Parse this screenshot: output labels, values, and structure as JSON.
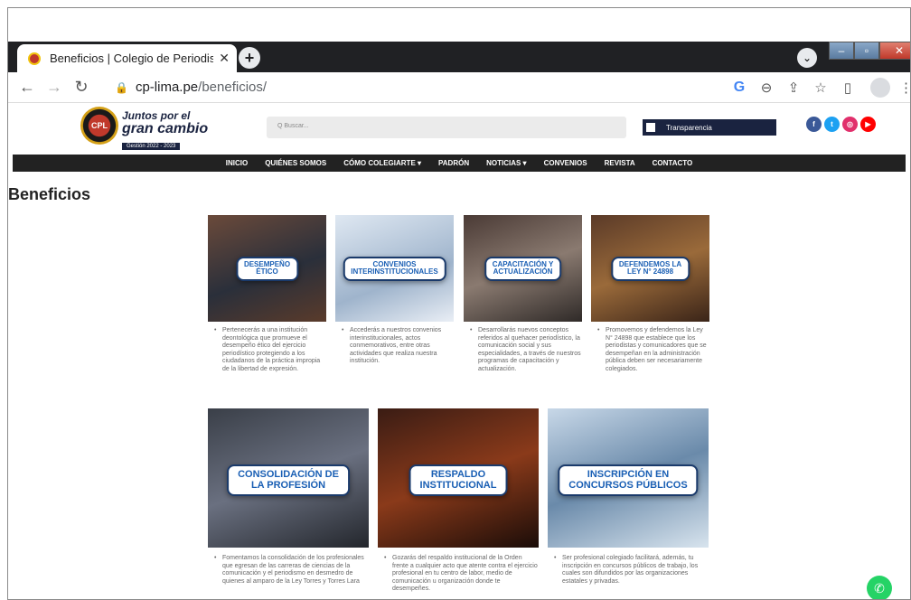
{
  "browser": {
    "tab_title": "Beneficios | Colegio de Periodista",
    "tab_close": "✕",
    "new_tab": "+",
    "tab_dropdown": "⌄",
    "url_domain": "cp-lima.pe",
    "url_path": "/beneficios/",
    "back": "←",
    "forward": "→",
    "reload": "↻",
    "lock": "🔒",
    "tb_icons": [
      "G",
      "⊖",
      "⇪",
      "☆",
      "▯",
      "⋮"
    ],
    "win": [
      "–",
      "▫",
      "✕"
    ]
  },
  "header": {
    "logo_text": "CPL",
    "slogan_1": "Juntos por el",
    "slogan_2": "gran cambio",
    "slogan_3": "Gestión 2022 - 2023",
    "search_placeholder": "Q  Buscar...",
    "transparencia": "Transparencia",
    "social": [
      {
        "icon": "f",
        "color": "#3b5998"
      },
      {
        "icon": "t",
        "color": "#1da1f2"
      },
      {
        "icon": "◎",
        "color": "#e1306c"
      },
      {
        "icon": "▶",
        "color": "#ff0000"
      }
    ]
  },
  "menu": [
    "INICIO",
    "QUIÉNES SOMOS",
    "CÓMO COLEGIARTE ▾",
    "PADRÓN",
    "NOTICIAS ▾",
    "CONVENIOS",
    "REVISTA",
    "CONTACTO"
  ],
  "page_title": "Beneficios",
  "cards": [
    {
      "banner": "DESEMPEÑO\nÉTICO",
      "desc": "Pertenecerás a una institución deontológica que promueve el desempeño ético del ejercicio periodístico protegiendo a los ciudadanos de la práctica impropia de la libertad de expresión."
    },
    {
      "banner": "CONVENIOS\nINTERINSTITUCIONALES",
      "desc": "Accederás a nuestros convenios interinstitucionales, actos conmemorativos, entre otras actividades que realiza nuestra institución."
    },
    {
      "banner": "CAPACITACIÓN Y\nACTUALIZACIÓN",
      "desc": "Desarrollarás nuevos conceptos referidos al quehacer periodístico, la comunicación social y sus especialidades, a través de nuestros programas de capacitación y actualización."
    },
    {
      "banner": "DEFENDEMOS LA\nLEY N° 24898",
      "desc": "Promovemos y defendemos la Ley N° 24898 que establece que los periodistas y comunicadores que se desempeñan en la administración pública deben ser necesariamente colegiados."
    },
    {
      "banner": "CONSOLIDACIÓN DE\nLA PROFESIÓN",
      "desc": "Fomentamos la consolidación de los profesionales que egresan de las carreras de ciencias de la comunicación y el periodismo en desmedro de quienes al amparo de la Ley Torres y Torres Lara"
    },
    {
      "banner": "RESPALDO\nINSTITUCIONAL",
      "desc": "Gozarás del respaldo institucional de la Orden frente a cualquier acto que atente contra el ejercicio profesional en tu centro de labor, medio de comunicación u organización donde te desempeñes."
    },
    {
      "banner": "INSCRIPCIÓN EN\nCONCURSOS PÚBLICOS",
      "desc": "Ser profesional colegiado facilitará, además, tu inscripción en concursos públicos de trabajo, los cuales son difundidos por las organizaciones estatales y privadas."
    }
  ],
  "whatsapp": "✆"
}
